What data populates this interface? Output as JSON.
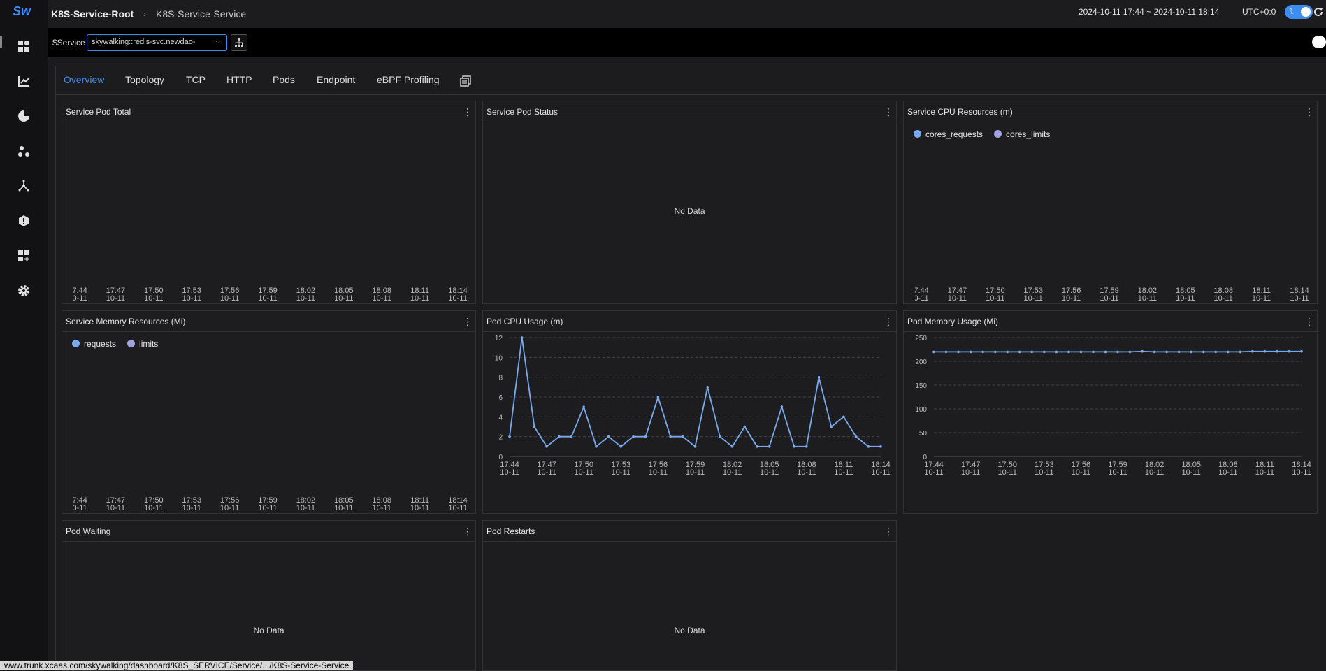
{
  "header": {
    "logo": "Sw",
    "breadcrumb_root": "K8S-Service-Root",
    "breadcrumb_current": "K8S-Service-Service",
    "time_range": "2024-10-11 17:44 ~ 2024-10-11 18:14",
    "timezone": "UTC+0:0"
  },
  "selector": {
    "label": "$Service",
    "value": "skywalking::redis-svc.newdao-"
  },
  "tabs": [
    "Overview",
    "Topology",
    "TCP",
    "HTTP",
    "Pods",
    "Endpoint",
    "eBPF Profiling"
  ],
  "active_tab": "Overview",
  "x_ticks": [
    {
      "time": "17:44",
      "date": "10-11"
    },
    {
      "time": "17:47",
      "date": "10-11"
    },
    {
      "time": "17:50",
      "date": "10-11"
    },
    {
      "time": "17:53",
      "date": "10-11"
    },
    {
      "time": "17:56",
      "date": "10-11"
    },
    {
      "time": "17:59",
      "date": "10-11"
    },
    {
      "time": "18:02",
      "date": "10-11"
    },
    {
      "time": "18:05",
      "date": "10-11"
    },
    {
      "time": "18:08",
      "date": "10-11"
    },
    {
      "time": "18:11",
      "date": "10-11"
    },
    {
      "time": "18:14",
      "date": "10-11"
    }
  ],
  "panels": {
    "pod_total": {
      "title": "Service Pod Total"
    },
    "pod_status": {
      "title": "Service Pod Status",
      "no_data": "No Data"
    },
    "cpu_resources": {
      "title": "Service CPU Resources (m)",
      "legend": [
        "cores_requests",
        "cores_limits"
      ]
    },
    "memory_resources": {
      "title": "Service Memory Resources (Mi)",
      "legend": [
        "requests",
        "limits"
      ]
    },
    "pod_cpu": {
      "title": "Pod CPU Usage (m)"
    },
    "pod_memory": {
      "title": "Pod Memory Usage (Mi)"
    },
    "pod_waiting": {
      "title": "Pod Waiting",
      "no_data": "No Data"
    },
    "pod_restarts": {
      "title": "Pod Restarts",
      "no_data": "No Data"
    }
  },
  "colors": {
    "accent": "#3d8ef0",
    "series_primary": "#79aaf0",
    "series_secondary": "#9fa3e0"
  },
  "chart_data": [
    {
      "type": "line",
      "title": "Pod CPU Usage (m)",
      "ylim": [
        0,
        12
      ],
      "yticks": [
        0,
        2,
        4,
        6,
        8,
        10,
        12
      ],
      "x_range": [
        "17:44",
        "18:14"
      ],
      "x": [
        "17:44",
        "17:45",
        "17:46",
        "17:47",
        "17:48",
        "17:49",
        "17:50",
        "17:51",
        "17:52",
        "17:53",
        "17:54",
        "17:55",
        "17:56",
        "17:57",
        "17:58",
        "17:59",
        "18:00",
        "18:01",
        "18:02",
        "18:03",
        "18:04",
        "18:05",
        "18:06",
        "18:07",
        "18:08",
        "18:09",
        "18:10",
        "18:11",
        "18:12",
        "18:13",
        "18:14"
      ],
      "values": [
        2,
        12,
        3,
        1,
        2,
        2,
        5,
        1,
        2,
        1,
        2,
        2,
        6,
        2,
        2,
        1,
        7,
        2,
        1,
        3,
        1,
        1,
        5,
        1,
        1,
        8,
        3,
        4,
        2,
        1,
        1
      ]
    },
    {
      "type": "line",
      "title": "Pod Memory Usage (Mi)",
      "ylim": [
        0,
        250
      ],
      "yticks": [
        0,
        50,
        100,
        150,
        200,
        250
      ],
      "x_range": [
        "17:44",
        "18:14"
      ],
      "x": [
        "17:44",
        "17:45",
        "17:46",
        "17:47",
        "17:48",
        "17:49",
        "17:50",
        "17:51",
        "17:52",
        "17:53",
        "17:54",
        "17:55",
        "17:56",
        "17:57",
        "17:58",
        "17:59",
        "18:00",
        "18:01",
        "18:02",
        "18:03",
        "18:04",
        "18:05",
        "18:06",
        "18:07",
        "18:08",
        "18:09",
        "18:10",
        "18:11",
        "18:12",
        "18:13",
        "18:14"
      ],
      "values": [
        220,
        220,
        220,
        220,
        220,
        220,
        220,
        220,
        220,
        220,
        220,
        220,
        220,
        220,
        220,
        220,
        220,
        221,
        220,
        220,
        220,
        220,
        220,
        220,
        220,
        220,
        221,
        221,
        221,
        221,
        221
      ]
    }
  ],
  "status_url": "www.trunk.xcaas.com/skywalking/dashboard/K8S_SERVICE/Service/.../K8S-Service-Service"
}
